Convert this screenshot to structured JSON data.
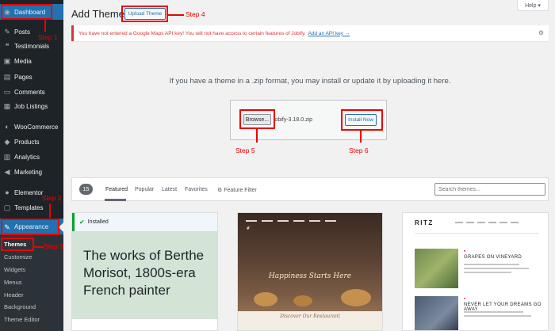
{
  "sidebar": {
    "items": [
      {
        "label": "Dashboard",
        "icon": "dashboard-icon"
      },
      {
        "label": "Posts",
        "icon": "pin-icon"
      },
      {
        "label": "Testimonials",
        "icon": "quote-icon"
      },
      {
        "label": "Media",
        "icon": "media-icon"
      },
      {
        "label": "Pages",
        "icon": "pages-icon"
      },
      {
        "label": "Comments",
        "icon": "comments-icon"
      },
      {
        "label": "Job Listings",
        "icon": "briefcase-icon"
      },
      {
        "label": "WooCommerce",
        "icon": "woocommerce-icon"
      },
      {
        "label": "Products",
        "icon": "products-icon"
      },
      {
        "label": "Analytics",
        "icon": "analytics-icon"
      },
      {
        "label": "Marketing",
        "icon": "megaphone-icon"
      },
      {
        "label": "Elementor",
        "icon": "elementor-icon"
      },
      {
        "label": "Templates",
        "icon": "templates-icon"
      },
      {
        "label": "Appearance",
        "icon": "brush-icon"
      }
    ],
    "submenu": [
      "Themes",
      "Customize",
      "Widgets",
      "Menus",
      "Header",
      "Background",
      "Theme Editor"
    ]
  },
  "header": {
    "title": "Add Themes",
    "upload_button": "Upload Theme",
    "help": "Help ▾"
  },
  "notice": {
    "text": "You have not entered a Google Maps API key! You will not have access to certain features of Jobify.",
    "link": "Add an API key →",
    "dismiss_icon": "gear-icon"
  },
  "upload": {
    "instruction": "If you have a theme in a .zip format, you may install or update it by uploading it here.",
    "browse_label": "Browse...",
    "file_name": "jobify-3.18.0.zip",
    "install_label": "Install Now"
  },
  "filter": {
    "count": "15",
    "tabs": [
      "Featured",
      "Popular",
      "Latest",
      "Favorites",
      "Feature Filter"
    ],
    "search_placeholder": "Search themes..."
  },
  "themes": {
    "card1": {
      "installed_label": "Installed",
      "headline": "The works of Berthe Morisot, 1800s-era French painter"
    },
    "card2": {
      "hero_text": "Happiness Starts Here",
      "bottom_text": "Discover Our Restaurant"
    },
    "card3": {
      "logo": "RITZ",
      "headline1": "GRAPES ON VINEYARD",
      "headline2": "NEVER LET YOUR DREAMS GO AWAY"
    }
  },
  "annotations": {
    "step1": "Step 1",
    "step2": "Step 2",
    "step3": "Step 3",
    "step4": "Step 4",
    "step5": "Step 5",
    "step6": "Step 6"
  },
  "colors": {
    "annotation": "#ee0000",
    "accent": "#2271b1",
    "sidebar": "#1d2327"
  }
}
